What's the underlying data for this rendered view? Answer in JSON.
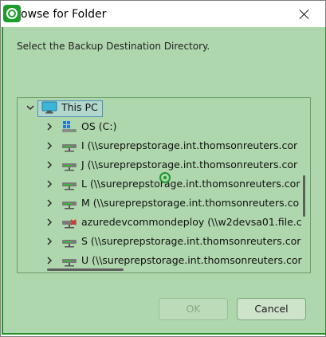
{
  "dialog": {
    "title": "owse for Folder",
    "instruction": "Select the Backup Destination Directory.",
    "ok_label": "OK",
    "cancel_label": "Cancel"
  },
  "tree": {
    "root": {
      "label": "This PC",
      "icon": "monitor-icon"
    },
    "items": [
      {
        "label": "OS (C:)",
        "icon": "windows-drive-icon"
      },
      {
        "label": "I (\\\\sureprepstorage.int.thomsonreuters.cor",
        "icon": "network-drive-icon"
      },
      {
        "label": "J (\\\\sureprepstorage.int.thomsonreuters.cor",
        "icon": "network-drive-icon"
      },
      {
        "label": "L (\\\\sureprepstorage.int.thomsonreuters.cor",
        "icon": "network-drive-icon"
      },
      {
        "label": "M (\\\\sureprepstorage.int.thomsonreuters.co",
        "icon": "network-drive-icon"
      },
      {
        "label": "azuredevcommondeploy (\\\\w2devsa01.file.c",
        "icon": "disconnected-drive-icon"
      },
      {
        "label": "S (\\\\sureprepstorage.int.thomsonreuters.cor",
        "icon": "network-drive-icon"
      },
      {
        "label": "U (\\\\sureprepstorage.int.thomsonreuters.cor",
        "icon": "network-drive-icon"
      }
    ]
  },
  "colors": {
    "overlay": "#98cc96",
    "accent": "#1e9d2e"
  }
}
